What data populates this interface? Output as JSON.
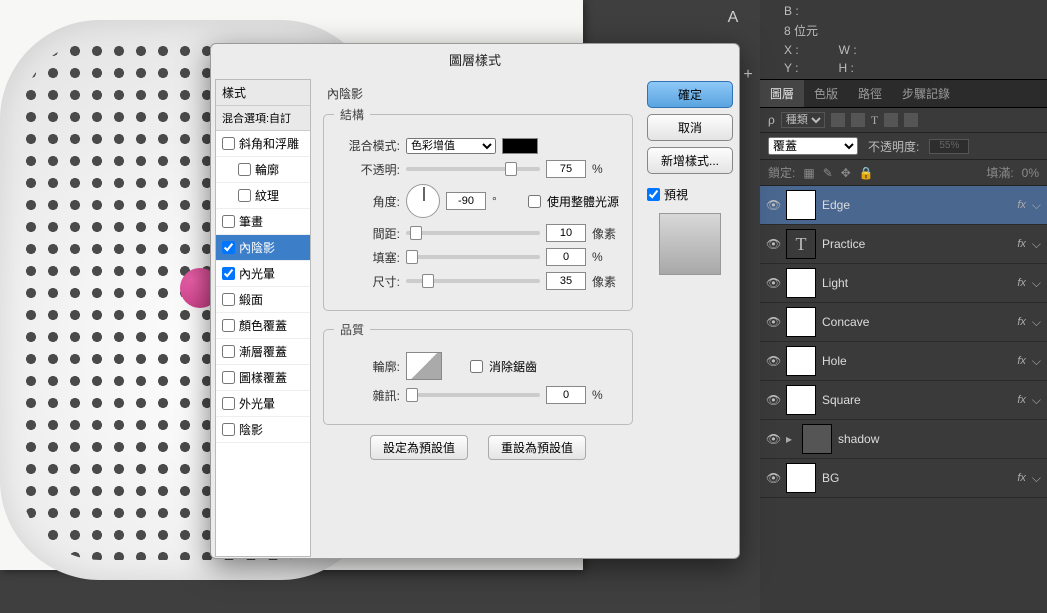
{
  "dialog": {
    "title": "圖層樣式",
    "styles_header": "樣式",
    "blend_header": "混合選項:自訂",
    "items": [
      {
        "label": "斜角和浮雕",
        "checked": false,
        "indent": false
      },
      {
        "label": "輪廓",
        "checked": false,
        "indent": true
      },
      {
        "label": "紋理",
        "checked": false,
        "indent": true
      },
      {
        "label": "筆畫",
        "checked": false,
        "indent": false
      },
      {
        "label": "內陰影",
        "checked": true,
        "indent": false,
        "selected": true
      },
      {
        "label": "內光暈",
        "checked": true,
        "indent": false
      },
      {
        "label": "緞面",
        "checked": false,
        "indent": false
      },
      {
        "label": "顏色覆蓋",
        "checked": false,
        "indent": false
      },
      {
        "label": "漸層覆蓋",
        "checked": false,
        "indent": false
      },
      {
        "label": "圖樣覆蓋",
        "checked": false,
        "indent": false
      },
      {
        "label": "外光暈",
        "checked": false,
        "indent": false
      },
      {
        "label": "陰影",
        "checked": false,
        "indent": false
      }
    ],
    "section_name": "內陰影",
    "structure": {
      "legend": "結構",
      "blend_mode_label": "混合模式:",
      "blend_mode_value": "色彩增值",
      "opacity_label": "不透明:",
      "opacity_value": "75",
      "opacity_unit": "%",
      "angle_label": "角度:",
      "angle_value": "-90",
      "angle_unit": "°",
      "global_light": "使用整體光源",
      "distance_label": "間距:",
      "distance_value": "10",
      "distance_unit": "像素",
      "choke_label": "填塞:",
      "choke_value": "0",
      "choke_unit": "%",
      "size_label": "尺寸:",
      "size_value": "35",
      "size_unit": "像素"
    },
    "quality": {
      "legend": "品質",
      "contour_label": "輪廓:",
      "antialias": "消除鋸齒",
      "noise_label": "雜訊:",
      "noise_value": "0",
      "noise_unit": "%"
    },
    "set_default": "設定為預設值",
    "reset_default": "重設為預設值",
    "ok": "確定",
    "cancel": "取消",
    "new_style": "新增樣式...",
    "preview": "預視"
  },
  "info": {
    "bits": "8 位元",
    "b_label": "B :",
    "x_label": "X :",
    "y_label": "Y :",
    "w_label": "W :",
    "h_label": "H :"
  },
  "panel": {
    "tabs": [
      "圖層",
      "色版",
      "路徑",
      "步驟記錄"
    ],
    "kind_label": "種類",
    "opacity_label": "不透明度:",
    "opacity_value": "55%",
    "blend_mode": "覆蓋",
    "lock_label": "鎖定:",
    "fill_label": "填滿:",
    "fill_value": "0%",
    "layers": [
      {
        "name": "Edge",
        "fx": true,
        "selected": true,
        "thumb": "img"
      },
      {
        "name": "Practice",
        "fx": true,
        "thumb": "txt"
      },
      {
        "name": "Light",
        "fx": true,
        "thumb": "img"
      },
      {
        "name": "Concave",
        "fx": true,
        "thumb": "img"
      },
      {
        "name": "Hole",
        "fx": true,
        "thumb": "img"
      },
      {
        "name": "Square",
        "fx": true,
        "thumb": "img"
      },
      {
        "name": "shadow",
        "fx": false,
        "thumb": "folder",
        "arrow": true
      },
      {
        "name": "BG",
        "fx": true,
        "thumb": "img"
      }
    ]
  }
}
